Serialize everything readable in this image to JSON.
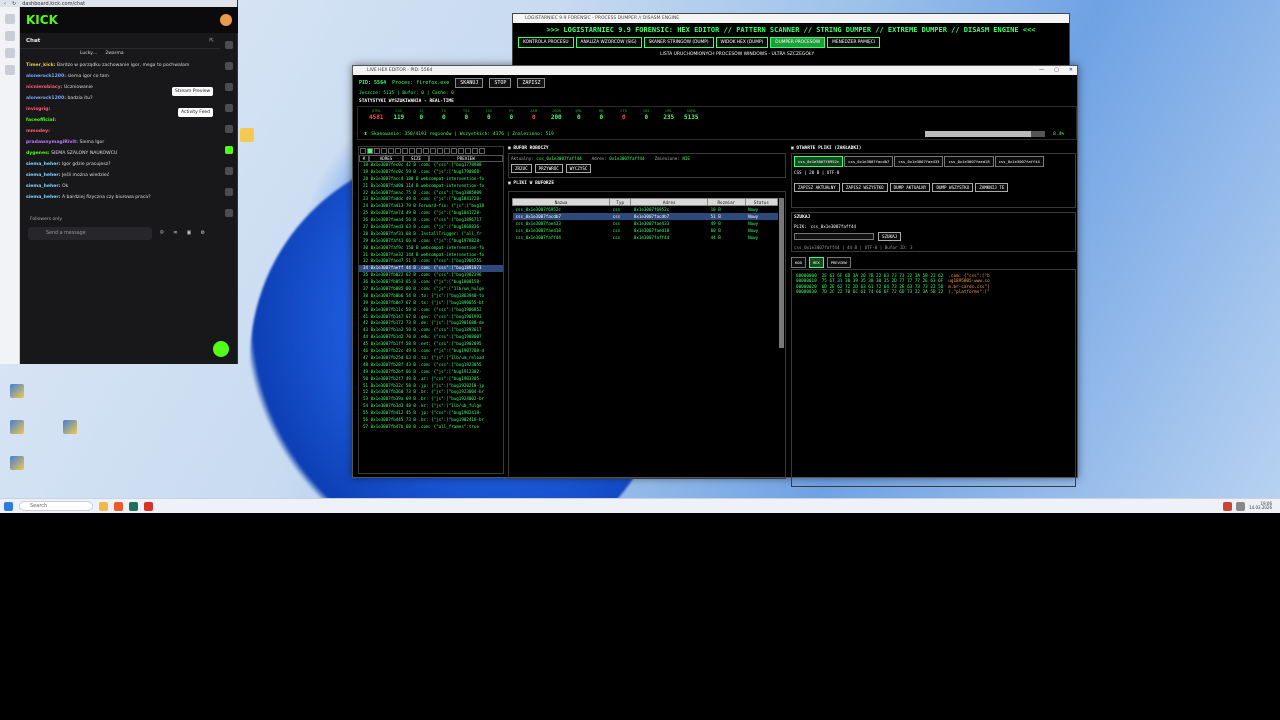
{
  "browser": {
    "url": "dashboard.kick.com/chat",
    "logo": "KICK",
    "chat_title": "Chat",
    "pinned": [
      "Lucky…",
      "2warma"
    ],
    "messages": [
      {
        "user": "Timer_kick:",
        "text": "Bardzo w porządku zachowanie igor, mega to pochwalam",
        "color": "#f2c94c"
      },
      {
        "user": "alonerock1200:",
        "text": "siema igor co tam",
        "color": "#7aa7ff"
      },
      {
        "user": "nicnierobiacy:",
        "text": "Uczniowanie",
        "color": "#ff5d7a"
      },
      {
        "user": "alonerock1200:",
        "text": "badzia itu?",
        "color": "#7aa7ff"
      },
      {
        "user": "invisgrig:",
        "text": "",
        "color": "#ff5d7a"
      },
      {
        "user": "faceofficial:",
        "text": "",
        "color": "#53fc18"
      },
      {
        "user": "mmodey:",
        "text": "",
        "color": "#ff5d7a"
      },
      {
        "user": "pradawnymagiRivit:",
        "text": "Siema Igor",
        "color": "#c07bff"
      },
      {
        "user": "dygenes:",
        "text": "SIEMA SZALONY NAUKOWCU",
        "color": "#53fc18"
      },
      {
        "user": "siema_heher:",
        "text": "Igor gdzie pracujesz?",
        "color": "#7fd3ff"
      },
      {
        "user": "siema_heher:",
        "text": "Jeśli można wiedzieć",
        "color": "#7fd3ff"
      },
      {
        "user": "siema_heher:",
        "text": "Ok",
        "color": "#7fd3ff"
      },
      {
        "user": "siema_heher:",
        "text": "A bardziej fizyczna czy biurowa praca?",
        "color": "#7fd3ff"
      }
    ],
    "tooltip_stream": "Stream Preview",
    "tooltip_activity": "Activity Feed",
    "followers_only": "Followers only",
    "send_placeholder": "Send a message"
  },
  "back_window": {
    "title": "LOGISTARNIEC 9.9 FORENSIC - PROCESS DUMPER // DISASM ENGINE",
    "header": ">>> LOGISTARNIEC 9.9 FORENSIC: HEX EDITOR // PATTERN SCANNER // STRING DUMPER // EXTREME DUMPER // DISASM ENGINE <<<",
    "tabs": [
      "KONTROLA PROCESU",
      "ANALIZA WZORCÓW (SIG)",
      "SKANER STRINGÓW (DUMP)",
      "WIDOK HEX (DUMP)",
      "DUMPER PROCESÓW",
      "MENEDŻER PAMIĘCI"
    ],
    "active_tab": 4,
    "subtitle": "LISTA URUCHOMIONYCH PROCESÓW WINDOWS - ULTRA SZCZEGÓŁY"
  },
  "main_window": {
    "title": "LIVE HEX EDITOR - PID: 5564",
    "pid_label": "PID: 5564",
    "process_label": "Proces: firefox.exe",
    "buttons": [
      "SKANUJ",
      "STOP",
      "ZAPISZ"
    ],
    "info": "Jeszcze: 5135 | Bufor: 0 | Cache: 0",
    "stats_title": "STATYSTYKI WYSZUKIWANIA - REAL-TIME",
    "stats": [
      {
        "label": "HTML",
        "value": "4581",
        "red": true
      },
      {
        "label": "CSS",
        "value": "119",
        "red": false
      },
      {
        "label": "JS",
        "value": "0",
        "red": false
      },
      {
        "label": "TS",
        "value": "0",
        "red": false
      },
      {
        "label": "TSX",
        "value": "0",
        "red": false
      },
      {
        "label": "JSX",
        "value": "0",
        "red": false
      },
      {
        "label": "PY",
        "value": "0",
        "red": false
      },
      {
        "label": "ASM",
        "value": "0",
        "red": true
      },
      {
        "label": "JSON",
        "value": "200",
        "red": false
      },
      {
        "label": "XML",
        "value": "0",
        "red": false
      },
      {
        "label": "MD",
        "value": "0",
        "red": false
      },
      {
        "label": "CFG",
        "value": "0",
        "red": true
      },
      {
        "label": "INI",
        "value": "0",
        "red": false
      },
      {
        "label": "URL",
        "value": "235",
        "red": false
      },
      {
        "label": "SUMA",
        "value": "5135",
        "red": false
      }
    ],
    "scan_text": "Skanowanie: 350/4191 regionów | Wszystkich: 4376 | Znaleziono: 519",
    "scan_progress": 0.88,
    "scan_pct": "8.4%",
    "left_headers": [
      "#",
      "ADRES",
      "SIZE",
      "PREVIEW"
    ],
    "hex_rows": [
      "18 0x1e3007fec0c 42 B  .com: {\"css\":[\"bug1778988",
      "19 0x1e3007fec0c 59 B  .com: {\"js\":[\"bug1790868-",
      "20 0x1e3007facc4 188 B webcompat-intervention-fo",
      "21 0x1e3007fad00 114 B webcompat-intervention-fo",
      "22 0x1e3007faeac 75 B  .com: {\"css\":[\"bug1885809",
      "23 0x1e3007faddc 49 B  .com: {\"js\":[\"bug1841728-",
      "24 0x1e3007fad13 79 B  Forward-fix: {\"js\":[\"bug18",
      "25 0x1e3007fae74 49 B  .com: {\"js\":[\"bug1841728-",
      "26 0x1e3007faea4 56 B  .com: {\"css\":[\"bug1896717",
      "27 0x1e3007faed3 63 B  .com: {\"js\":[\"bug1868836-",
      "28 0x1e3007faf31 68 B  .InstallTrigger: {\"all_fr",
      "29 0x1e3007faf41 66 B  .com: {\"js\":[\"bug1978828-",
      "30 0x1e3007faf9c 150 B webcompat-intervention-fo",
      "31 0x1e3007fae32 144 B webcompat-intervention-fo",
      "32 0x1e3007facd7 51 B  .com: {\"css\":[\"bug1904755",
      "34 0x1e3007faeff 44 B  .com: {\"css\":[\"bug1891873",
      "35 0x1e3007fb022 62 B  .com: {\"css\":[\"bug1902396",
      "36 0x1e3007fb053 65 B  .com: {\"js\":[\"bug1800158-",
      "37 0x1e3007fb085 80 B  .com: {\"js\":[\"1lb/um_hulge",
      "38 0x1e3007fb0b6 54 B  .to: {\"js\":[\"bug1863940-to",
      "39 0x1e3007fb0e7 67 B  .tx: {\"js\":[\"bug1890055-bt",
      "40 0x1e3007fb11c 58 B  .com: {\"css\":[\"bug1906852",
      "41 0x1e3007fb147 67 B  .gov: {\"css\":[\"bug1901993",
      "42 0x1e3007fb172 73 B  .de: {\"js\":[\"bug1901688-de",
      "43 0x1e3007fb1a2 50 B  .com: {\"css\":[\"bug1893617",
      "44 0x1e3007fb1d2 70 B  .edu: {\"css\":[\"bug1908007",
      "45 0x1e3007fb1ff 58 B  .net: {\"css\":[\"bug1902095",
      "46 0x1e3007fb22c 49 B  .com: {\"js\":[\"bug1907708-d",
      "47 0x1e3007fb25d 63 B  .to: {\"js\":[\"1lb/um_reload",
      "48 0x1e3007fb28f 43 B  .com: {\"css\":[\"bug1923055",
      "49 0x1e3007fb2bf 66 B  .com: {\"js\":[\"bug1912302-",
      "50 0x1e3007fb2f7 49 B  .ar: {\"css\":[\"bug1903305-",
      "51 0x1e3007fb32c 58 B  .jp: {\"js\":[\"bug1920218-jp",
      "52 0x1e3007fb360 73 B  .br: {\"js\":[\"bug1923004-br",
      "53 0x1e3007fb39a 69 B  .br: {\"js\":[\"bug1924002-br",
      "54 0x1e3007fb3d3 48 B  .kr: {\"js\":[\"1lb/ub_fulge",
      "55 0x1e3007fb412 45 B  .jp: {\"css\":[\"bug1902418-",
      "56 0x1e3007fb445 73 B  .br: {\"js\":[\"bug1902416-br",
      "57 0x1e3007fb47b 68 B  .com: {\"all_frames\":true"
    ],
    "selected_hex_row": 15,
    "work_buffer_title": "BUFOR ROBOCZY",
    "work_buffer_label": "Aktualny:",
    "work_buffer_value": "css_0x1e3007faff44",
    "address_label": "Adres:",
    "address_value": "0x1e3007faff44",
    "changes_label": "Zmienione:",
    "changes_value": "NIE",
    "work_buttons": [
      "ZRZUĆ",
      "PRZYWRÓĆ",
      "WYCZYŚĆ"
    ],
    "files_title": "PLIKI W BUFORZE",
    "files_headers": [
      "Nazwa",
      "Typ",
      "Adres",
      "Rozmiar",
      "Status"
    ],
    "files": [
      [
        "css_0x1e3007f6952c",
        "css",
        "0x1e3007f6952c",
        "18 B",
        "Nowy"
      ],
      [
        "css_0x1e3007facdb7",
        "css",
        "0x1e3007facdb7",
        "51 B",
        "Nowy"
      ],
      [
        "css_0x1e3007fae433",
        "css",
        "0x1e3007fae433",
        "49 B",
        "Nowy"
      ],
      [
        "css_0x1e3007faed18",
        "css",
        "0x1e3007faed18",
        "60 B",
        "Nowy"
      ],
      [
        "css_0x1e3007faff44",
        "css",
        "0x1e3007faff44",
        "44 B",
        "Nowy"
      ]
    ],
    "selected_file": 1,
    "open_title": "OTWARTE PLIKI (ZAKŁADKI)",
    "open_tabs": [
      "css_0x1e3007f6952c",
      "css_0x1e3007facdb7",
      "css_0x1e3007fae433",
      "css_0x1e3007faed18",
      "css_0x1e3007faff44"
    ],
    "csv_info": "CSS | 28 B | UTF-8",
    "action_buttons": [
      "ZAPISZ AKTUALNY",
      "ZAPISZ WSZYSTKO",
      "DUMP AKTUALNY",
      "DUMP WSZYSTKO",
      "ZAMKNIJ TE"
    ],
    "search_title": "SZUKAJ",
    "search_label": "PLIK:",
    "search_file": "css_0x1e3007faff44",
    "search_button": "SZUKAJ",
    "path_info": "css_0x1e3007faff44 | 44 B | UTF-8 | Bufor ID: 3",
    "view_tabs": [
      "KOD",
      "HEX",
      "PREVIEW"
    ],
    "active_view": 1,
    "hex_lines": [
      {
        "a": "00000000",
        "h": "2E 63 6F 6D 3A 20 7B 22 63 73 73 22 3A 5B 22 62",
        "t": ".com: {\"css\":[\"b"
      },
      {
        "a": "00000010",
        "h": "75 67 31 38 39 35 38 30 35 2D 77 77 77 2E 63 6F",
        "t": "ug1895805-www.co"
      },
      {
        "a": "00000020",
        "h": "6D 2E 62 72 2D 63 61 72 64 73 2E 63 73 73 22 5D",
        "t": "m.br-cards.css\"]"
      },
      {
        "a": "00000030",
        "h": "7D 2C 22 70 6C 61 74 66 6F 72 6D 73 22 3A 5B 22",
        "t": "},\"platforms\":[\""
      }
    ]
  },
  "taskbar": {
    "search": "Search",
    "time": "19:06",
    "date": "14.03.2026"
  }
}
